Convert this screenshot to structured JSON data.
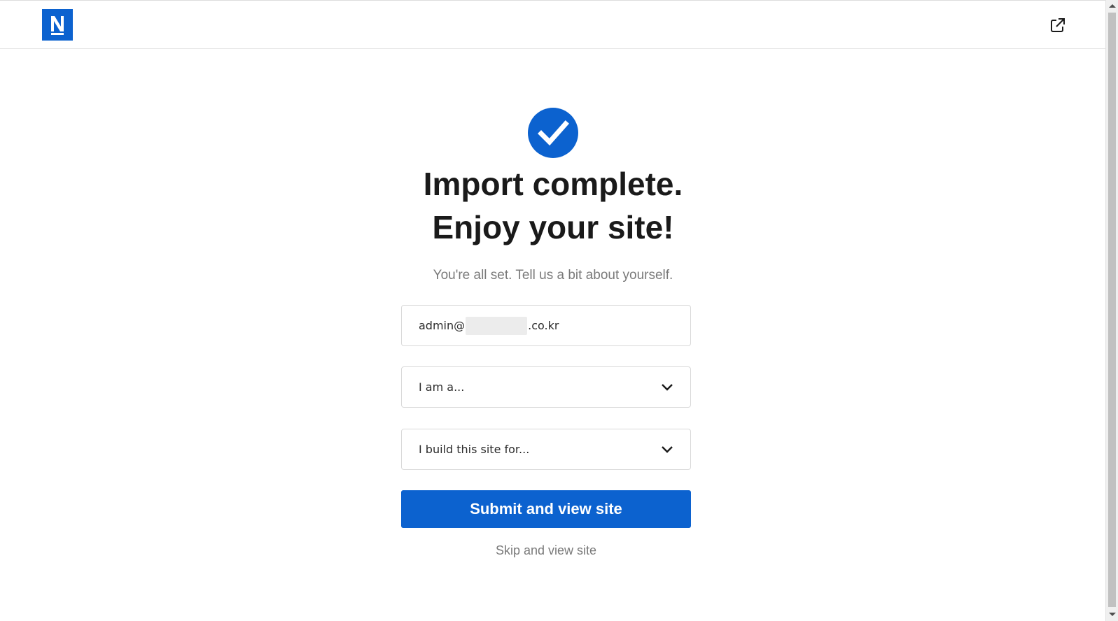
{
  "header": {
    "logo_icon": "n-logo-icon",
    "logo_letter": "N",
    "external_link_icon": "external-link-icon",
    "brand_color": "#0c62cf"
  },
  "status": {
    "icon": "check-circle-icon",
    "title_line1": "Import complete.",
    "title_line2": "Enjoy your site!",
    "subtitle": "You're all set. Tell us a bit about yourself."
  },
  "form": {
    "email_user": "admin@",
    "email_domain_suffix": ".co.kr",
    "role_select_label": "I am a...",
    "purpose_select_label": "I build this site for...",
    "submit_label": "Submit and view site",
    "skip_label": "Skip and view site"
  },
  "colors": {
    "primary": "#0c62cf",
    "heading": "#1a1a1a",
    "muted": "#7a7a7a",
    "border": "#d9d9d9"
  }
}
